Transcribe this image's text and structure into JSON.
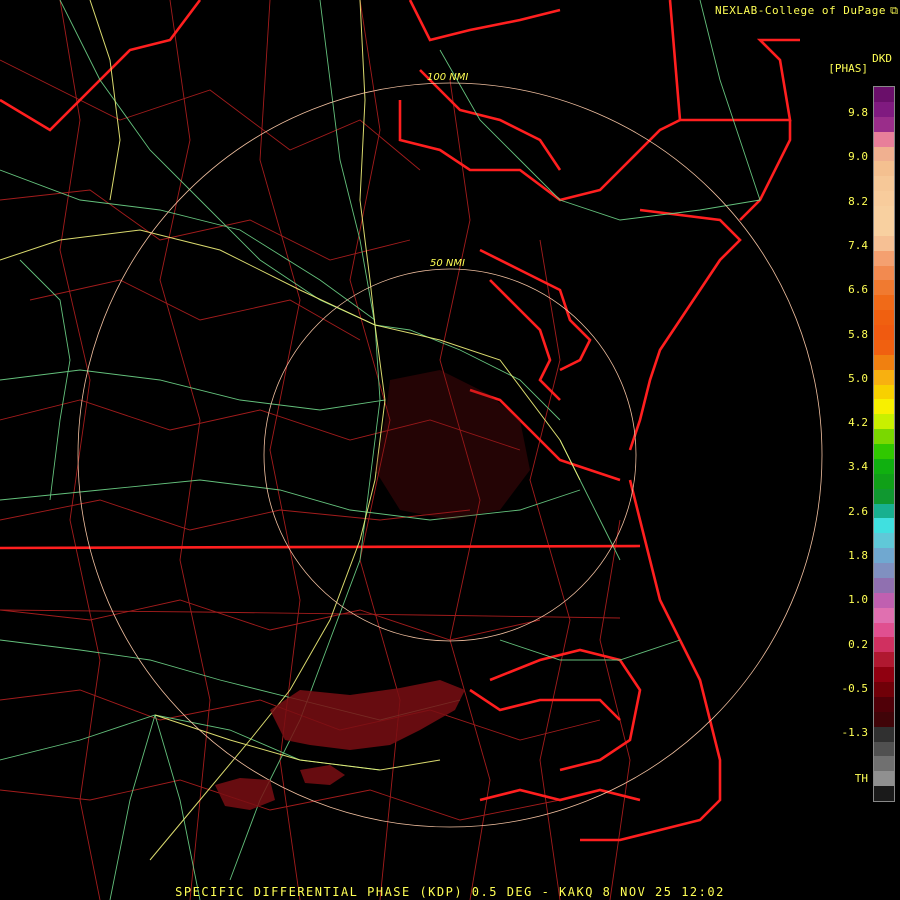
{
  "header": {
    "credit": "NEXLAB-College of DuPage",
    "credit_icon": "external-link-icon"
  },
  "footer": {
    "product_line": "SPECIFIC DIFFERENTIAL PHASE (KDP) 0.5 DEG - KAKQ 8 NOV 25 12:02"
  },
  "map": {
    "range_rings": [
      "50 NMI",
      "100 NMI"
    ],
    "colors": {
      "boundaries": "#ff1f1f",
      "counties": "#b52020",
      "roads_green": "#6fd68a",
      "roads_yellow": "#f2f27a",
      "rings": "#f2c0a0",
      "echo": "#7a0f14"
    }
  },
  "legend": {
    "unit_line1": "DKD",
    "unit_line2": "[PHAS]",
    "ticks": [
      "9.8",
      "9.0",
      "8.2",
      "7.4",
      "6.6",
      "5.8",
      "5.0",
      "4.2",
      "3.4",
      "2.6",
      "1.8",
      "1.0",
      "0.2",
      "-0.5",
      "-1.3",
      "TH"
    ],
    "swatches": [
      "#6a0f6a",
      "#801a80",
      "#9a2d8a",
      "#e87f9a",
      "#f0b090",
      "#f4c090",
      "#f6c898",
      "#f8cc9c",
      "#f8d0a0",
      "#f8d0a0",
      "#f6c094",
      "#f4a070",
      "#f28a50",
      "#f07a30",
      "#f06a18",
      "#f06010",
      "#f05a10",
      "#f06010",
      "#f08010",
      "#f8b010",
      "#f8d000",
      "#f8f000",
      "#c8f000",
      "#7ad800",
      "#30c800",
      "#10b010",
      "#10a018",
      "#109830",
      "#18b090",
      "#40e0e0",
      "#60c8d8",
      "#70a8d0",
      "#8090c0",
      "#9070b0",
      "#c060b0",
      "#e070b0",
      "#e05090",
      "#d03060",
      "#b01830",
      "#900010",
      "#700008",
      "#500008",
      "#400408",
      "#303030",
      "#505050",
      "#707070",
      "#909090",
      "#1a1a1a"
    ]
  }
}
